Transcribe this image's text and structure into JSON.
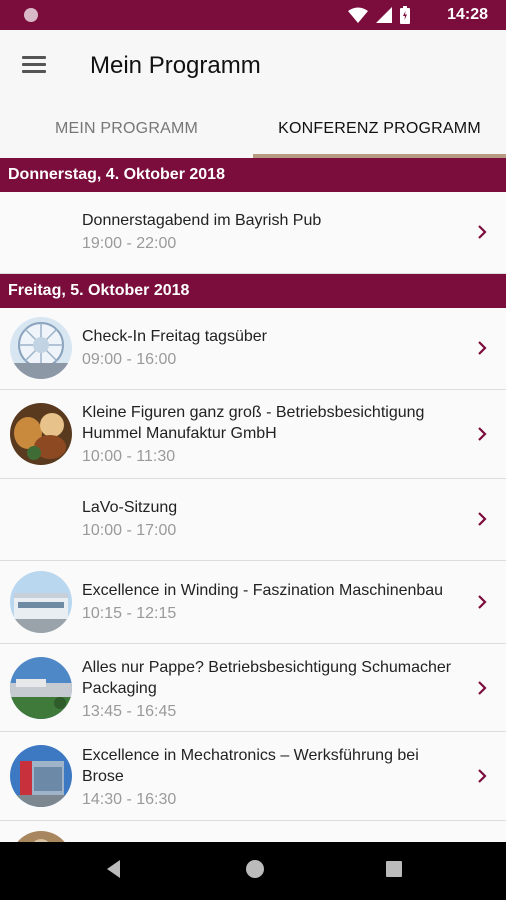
{
  "status_bar": {
    "time": "14:28"
  },
  "app_bar": {
    "title": "Mein Programm"
  },
  "tabs": [
    {
      "label": "MEIN PROGRAMM",
      "selected": false
    },
    {
      "label": "KONFERENZ PROGRAMM",
      "selected": true
    }
  ],
  "colors": {
    "accent": "#7a0d3c",
    "tab_indicator": "#b69a82",
    "muted_text": "#9a9a9a"
  },
  "sections": [
    {
      "date": "Donnerstag, 4. Oktober 2018",
      "events": [
        {
          "title": "Donnerstagabend im Bayrish Pub",
          "time": "19:00 - 22:00",
          "has_image": false
        }
      ]
    },
    {
      "date": "Freitag, 5. Oktober 2018",
      "events": [
        {
          "title": "Check-In Freitag tagsüber",
          "time": "09:00 - 16:00",
          "has_image": true,
          "image": "glass-dome-photo"
        },
        {
          "title": "Kleine Figuren ganz groß - Betriebsbesichtigung Hummel Manufaktur GmbH",
          "time": "10:00 - 11:30",
          "has_image": true,
          "image": "figurines-photo"
        },
        {
          "title": "LaVo-Sitzung",
          "time": "10:00 - 17:00",
          "has_image": false
        },
        {
          "title": "Excellence in Winding - Faszination Maschinenbau",
          "time": "10:15 - 12:15",
          "has_image": true,
          "image": "factory-building-photo"
        },
        {
          "title": "Alles nur Pappe? Betriebsbesichtigung Schumacher Packaging",
          "time": "13:45 - 16:45",
          "has_image": true,
          "image": "industrial-site-photo"
        },
        {
          "title": "Excellence in Mechatronics – Werksführung bei Brose",
          "time": "14:30 - 16:30",
          "has_image": true,
          "image": "brose-building-photo"
        }
      ]
    }
  ]
}
